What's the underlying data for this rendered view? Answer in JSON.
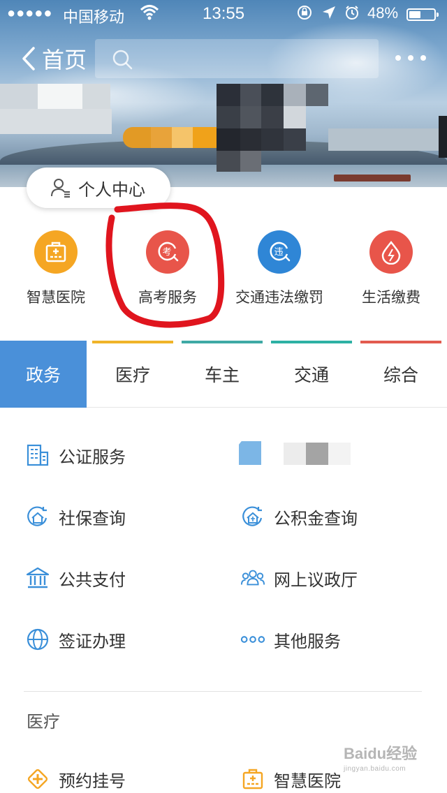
{
  "status_bar": {
    "signal": "●●●●●",
    "carrier": "中国移动",
    "time": "13:55",
    "battery_percent": "48%",
    "battery_level": 0.48
  },
  "nav": {
    "back_label": "首页"
  },
  "personal_center": {
    "label": "个人中心"
  },
  "quick_services": [
    {
      "label": "智慧医院",
      "color": "#f5a623",
      "icon": "hospital-icon"
    },
    {
      "label": "高考服务",
      "color": "#e8554a",
      "icon": "exam-icon"
    },
    {
      "label": "交通违法缴罚",
      "color": "#2f86d6",
      "icon": "traffic-violation-icon"
    },
    {
      "label": "生活缴费",
      "color": "#e8554a",
      "icon": "utility-bill-icon"
    }
  ],
  "annotation": {
    "color": "#e0151e"
  },
  "tabs": [
    {
      "label": "政务",
      "active": true,
      "color": "#4a90d9"
    },
    {
      "label": "医疗",
      "active": false,
      "color": "#f0b429"
    },
    {
      "label": "车主",
      "active": false,
      "color": "#3fa9a5"
    },
    {
      "label": "交通",
      "active": false,
      "color": "#2db1a4"
    },
    {
      "label": "综合",
      "active": false,
      "color": "#e25b4f"
    }
  ],
  "services": [
    {
      "label": "公证服务",
      "icon": "building-icon"
    },
    {
      "label": "社保查询",
      "icon": "social-security-icon"
    },
    {
      "label": "公积金查询",
      "icon": "housing-fund-icon"
    },
    {
      "label": "公共支付",
      "icon": "bank-icon"
    },
    {
      "label": "网上议政厅",
      "icon": "people-group-icon"
    },
    {
      "label": "签证办理",
      "icon": "globe-icon"
    },
    {
      "label": "其他服务",
      "icon": "more-dots-icon"
    }
  ],
  "medical_section": {
    "title": "医疗",
    "items": [
      {
        "label": "预约挂号",
        "icon": "appointment-icon"
      },
      {
        "label": "智慧医院",
        "icon": "hospital-icon"
      }
    ]
  },
  "watermark": {
    "brand": "Baidu经验",
    "url": "jingyan.baidu.com"
  },
  "colors": {
    "accent_blue": "#4a90d9",
    "service_icon_blue": "#3a8fd9",
    "medical_icon_orange": "#f5a623"
  }
}
